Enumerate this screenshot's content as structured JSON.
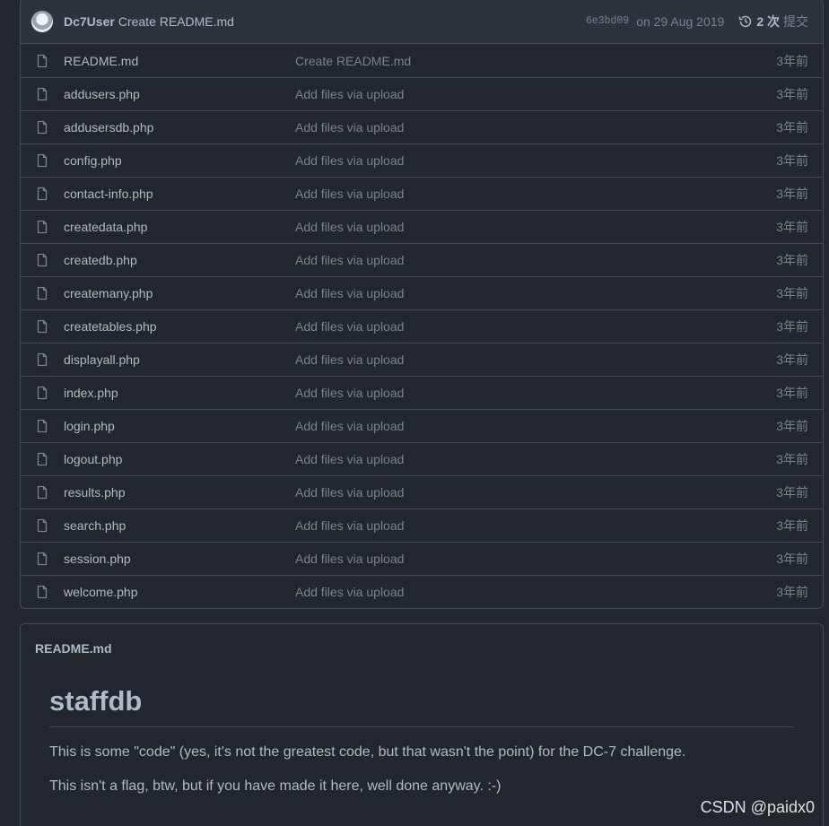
{
  "commit": {
    "author": "Dc7User",
    "message": "Create README.md",
    "sha": "6e3bd09",
    "date": "on 29 Aug 2019",
    "history_count": "2 次",
    "history_label": "提交"
  },
  "files": [
    {
      "name": "README.md",
      "commit": "Create README.md",
      "age": "3年前"
    },
    {
      "name": "addusers.php",
      "commit": "Add files via upload",
      "age": "3年前"
    },
    {
      "name": "addusersdb.php",
      "commit": "Add files via upload",
      "age": "3年前"
    },
    {
      "name": "config.php",
      "commit": "Add files via upload",
      "age": "3年前"
    },
    {
      "name": "contact-info.php",
      "commit": "Add files via upload",
      "age": "3年前"
    },
    {
      "name": "createdata.php",
      "commit": "Add files via upload",
      "age": "3年前"
    },
    {
      "name": "createdb.php",
      "commit": "Add files via upload",
      "age": "3年前"
    },
    {
      "name": "createmany.php",
      "commit": "Add files via upload",
      "age": "3年前"
    },
    {
      "name": "createtables.php",
      "commit": "Add files via upload",
      "age": "3年前"
    },
    {
      "name": "displayall.php",
      "commit": "Add files via upload",
      "age": "3年前"
    },
    {
      "name": "index.php",
      "commit": "Add files via upload",
      "age": "3年前"
    },
    {
      "name": "login.php",
      "commit": "Add files via upload",
      "age": "3年前"
    },
    {
      "name": "logout.php",
      "commit": "Add files via upload",
      "age": "3年前"
    },
    {
      "name": "results.php",
      "commit": "Add files via upload",
      "age": "3年前"
    },
    {
      "name": "search.php",
      "commit": "Add files via upload",
      "age": "3年前"
    },
    {
      "name": "session.php",
      "commit": "Add files via upload",
      "age": "3年前"
    },
    {
      "name": "welcome.php",
      "commit": "Add files via upload",
      "age": "3年前"
    }
  ],
  "readme": {
    "filename": "README.md",
    "title": "staffdb",
    "paragraphs": [
      "This is some \"code\" (yes, it's not the greatest code, but that wasn't the point) for the DC-7 challenge.",
      "This isn't a flag, btw, but if you have made it here, well done anyway. :-)"
    ]
  },
  "watermark": "CSDN @paidx0",
  "colors": {
    "background": "#22272e",
    "header_bg": "#2d333b",
    "border": "#444c56",
    "text": "#adbac7",
    "muted": "#768390"
  },
  "icons": {
    "file": "file-icon",
    "history": "history-icon"
  }
}
